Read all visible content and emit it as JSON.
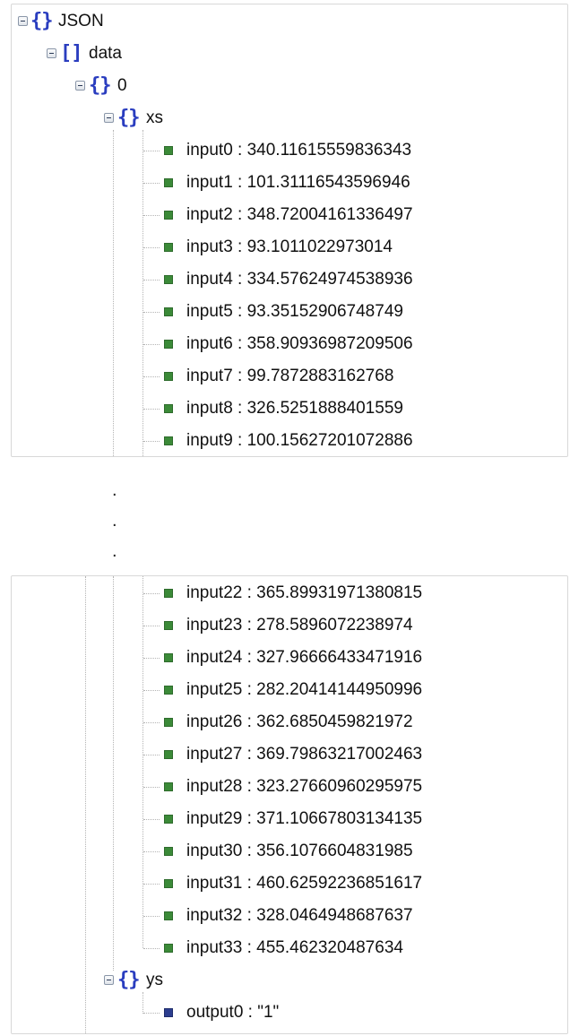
{
  "root": {
    "label": "JSON"
  },
  "data": {
    "label": "data"
  },
  "item0": {
    "label": "0"
  },
  "xs": {
    "label": "xs",
    "top_items": [
      "input0 : 340.11615559836343",
      "input1 : 101.31116543596946",
      "input2 : 348.72004161336497",
      "input3 : 93.1011022973014",
      "input4 : 334.57624974538936",
      "input5 : 93.35152906748749",
      "input6 : 358.90936987209506",
      "input7 : 99.7872883162768",
      "input8 : 326.5251888401559",
      "input9 : 100.15627201072886"
    ],
    "bottom_items": [
      "input22 : 365.89931971380815",
      "input23 : 278.5896072238974",
      "input24 : 327.96666433471916",
      "input25 : 282.20414144950996",
      "input26 : 362.6850459821972",
      "input27 : 369.79863217002463",
      "input28 : 323.27660960295975",
      "input29 : 371.10667803134135",
      "input30 : 356.1076604831985",
      "input31 : 460.62592236851617",
      "input32 : 328.0464948687637",
      "input33 : 455.462320487634"
    ]
  },
  "ys": {
    "label": "ys",
    "items": [
      "output0 : \"1\""
    ]
  },
  "ellipsis": ".",
  "icons": {
    "object": "braces-icon",
    "array": "brackets-icon",
    "leaf_xs": "green-square-icon",
    "leaf_ys": "blue-square-icon",
    "toggle": "collapse-minus-icon"
  },
  "colors": {
    "brace": "#2a3dbf",
    "leaf_green": "#3b8a38",
    "leaf_blue": "#2c3e8f"
  }
}
